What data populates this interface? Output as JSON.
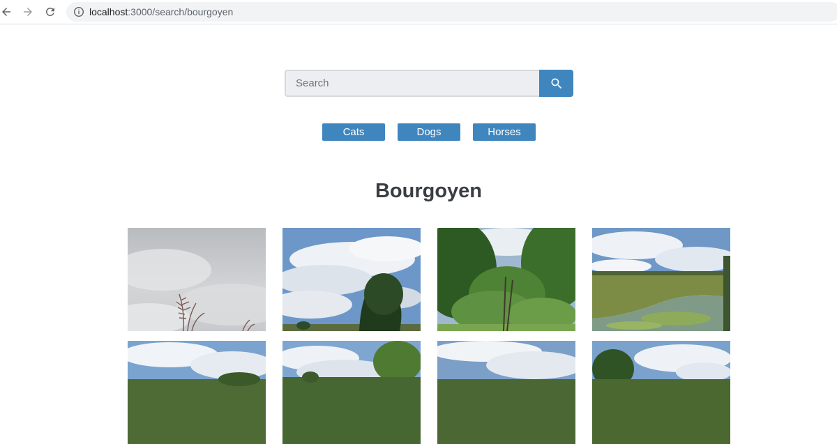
{
  "browser": {
    "url_host": "localhost",
    "url_path": ":3000/search/bourgoyen",
    "icons": {
      "back": "arrow-left-icon",
      "forward": "arrow-right-icon",
      "reload": "reload-icon",
      "site_info": "info-icon"
    }
  },
  "search": {
    "placeholder": "Search",
    "value": "",
    "button_icon": "search-icon"
  },
  "categories": [
    {
      "label": "Cats"
    },
    {
      "label": "Dogs"
    },
    {
      "label": "Horses"
    }
  ],
  "page_title": "Bourgoyen",
  "colors": {
    "accent": "#3f86bf",
    "title": "#3a3e42",
    "input_bg": "#eceef1"
  }
}
